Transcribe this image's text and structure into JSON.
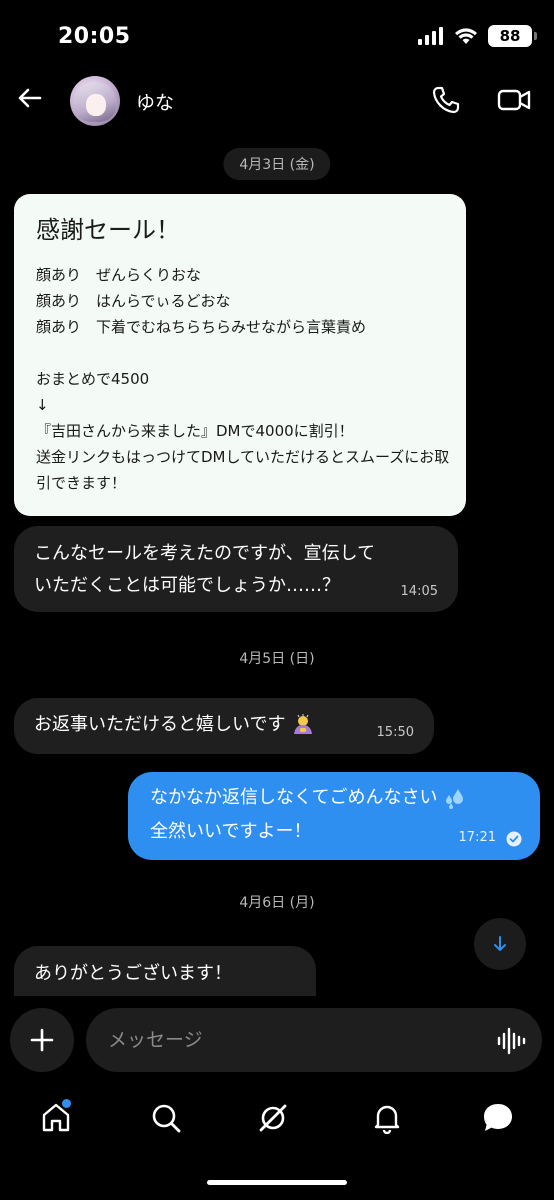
{
  "status_bar": {
    "time": "20:05",
    "battery": "88"
  },
  "header": {
    "contact_name": "ゆな"
  },
  "messages": {
    "date1": "4月3日 (金)",
    "card_title": "感謝セール！",
    "card_body": "顔あり　ぜんらくりおな\n顔あり　はんらでぃるどおな\n顔あり　下着でむねちらちらみせながら言葉責め\n\nおまとめで4500\n↓\n『吉田さんから来ました』DMで4000に割引！\n送金リンクもはっつけてDMしていただけるとスムーズにお取引できます！",
    "msg1_text": "こんなセールを考えたのですが、宣伝して\nいただくことは可能でしょうか……？",
    "msg1_time": "14:05",
    "date2": "4月5日 (日)",
    "msg2_text": "お返事いただけると嬉しいです",
    "msg2_time": "15:50",
    "msg3_line1": "なかなか返信しなくてごめんなさい",
    "msg3_line2": "全然いいですよー！",
    "msg3_time": "17:21",
    "date3": "4月6日 (月)",
    "msg4_text": "ありがとうございます！"
  },
  "composer": {
    "placeholder": "メッセージ"
  },
  "icons": {
    "back": "arrow-left-icon",
    "call": "phone-icon",
    "video": "video-camera-icon",
    "plus": "plus-icon",
    "voice": "waveform-icon",
    "scroll": "arrow-down-icon",
    "home": "home-icon",
    "search": "search-icon",
    "grok": "slash-circle-icon",
    "notifications": "bell-icon",
    "messages": "chat-bubble-icon",
    "read": "check-circle-icon",
    "emoji_bow": "person-bowing-emoji",
    "emoji_sweat": "sweat-droplets-emoji"
  },
  "colors": {
    "accent": "#2e8ff0",
    "incoming_bubble": "#1f1f1f",
    "card_bg": "#f4faf5",
    "background": "#000000"
  }
}
